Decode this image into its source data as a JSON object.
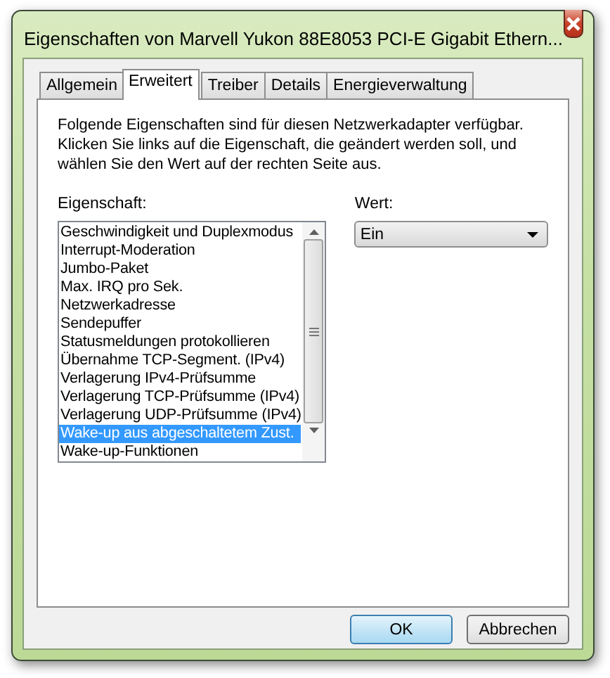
{
  "window": {
    "title": "Eigenschaften von Marvell Yukon 88E8053 PCI-E Gigabit Ethern..."
  },
  "tabs": [
    {
      "label": "Allgemein",
      "selected": false
    },
    {
      "label": "Erweitert",
      "selected": true
    },
    {
      "label": "Treiber",
      "selected": false
    },
    {
      "label": "Details",
      "selected": false
    },
    {
      "label": "Energieverwaltung",
      "selected": false
    }
  ],
  "description": "Folgende Eigenschaften sind für diesen Netzwerkadapter verfügbar. Klicken Sie links auf die Eigenschaft, die geändert werden soll, und wählen Sie den Wert auf der rechten Seite aus.",
  "property_label": "Eigenschaft:",
  "properties": [
    {
      "label": "Geschwindigkeit und Duplexmodus",
      "selected": false
    },
    {
      "label": "Interrupt-Moderation",
      "selected": false
    },
    {
      "label": "Jumbo-Paket",
      "selected": false
    },
    {
      "label": "Max. IRQ pro Sek.",
      "selected": false
    },
    {
      "label": "Netzwerkadresse",
      "selected": false
    },
    {
      "label": "Sendepuffer",
      "selected": false
    },
    {
      "label": "Statusmeldungen protokollieren",
      "selected": false
    },
    {
      "label": "Übernahme TCP-Segment. (IPv4)",
      "selected": false
    },
    {
      "label": "Verlagerung IPv4-Prüfsumme",
      "selected": false
    },
    {
      "label": "Verlagerung TCP-Prüfsumme (IPv4)",
      "selected": false
    },
    {
      "label": "Verlagerung UDP-Prüfsumme (IPv4)",
      "selected": false
    },
    {
      "label": "Wake-up aus abgeschaltetem Zust.",
      "selected": true
    },
    {
      "label": "Wake-up-Funktionen",
      "selected": false
    }
  ],
  "value_label": "Wert:",
  "value": "Ein",
  "buttons": [
    {
      "label": "OK",
      "kind": "default"
    },
    {
      "label": "Abbrechen",
      "kind": "normal"
    }
  ]
}
